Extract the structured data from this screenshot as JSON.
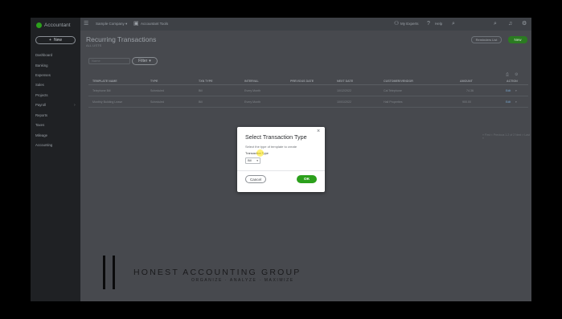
{
  "app": {
    "logo_text": "Accountant",
    "new_button": "New",
    "new_icon": "plus-icon"
  },
  "sidebar": {
    "items": [
      {
        "label": "Dashboard"
      },
      {
        "label": "Banking"
      },
      {
        "label": "Expenses"
      },
      {
        "label": "Sales"
      },
      {
        "label": "Projects"
      },
      {
        "label": "Payroll"
      },
      {
        "label": "Reports"
      },
      {
        "label": "Taxes"
      },
      {
        "label": "Mileage"
      },
      {
        "label": "Accounting"
      }
    ]
  },
  "topbar": {
    "company": "Sample Company",
    "tools_label": "Accountant Tools",
    "experts_label": "My Experts",
    "help_label": "Help"
  },
  "page": {
    "title": "Recurring Transactions",
    "subtitle": "ALL LISTS",
    "remind_list": "Reminders List",
    "new_label": "New",
    "filter_label": "Filter",
    "search_placeholder": "Name"
  },
  "table": {
    "headers": [
      "TEMPLATE NAME",
      "TYPE",
      "TXN TYPE",
      "INTERVAL",
      "PREVIOUS DATE",
      "NEXT DATE",
      "CUSTOMER/VENDOR",
      "AMOUNT",
      "ACTION"
    ],
    "rows": [
      {
        "name": "Telephone Bill",
        "type": "Scheduled",
        "txn": "Bill",
        "interval": "Every Month",
        "prev": "",
        "next": "10/12/2022",
        "party": "Cal Telephone",
        "amount": "74.36",
        "action": "Edit"
      },
      {
        "name": "Monthly Building Lease",
        "type": "Scheduled",
        "txn": "Bill",
        "interval": "Every Month",
        "prev": "",
        "next": "10/01/2022",
        "party": "Hall Properties",
        "amount": "900.00",
        "action": "Edit"
      }
    ],
    "pager": "« First  < Previous  1-2 of 2  Next >  Last »"
  },
  "modal": {
    "title": "Select Transaction Type",
    "description": "Select the type of template to create",
    "field_label": "Transaction Type",
    "field_value": "Bill",
    "cancel": "Cancel",
    "ok": "OK",
    "close_icon": "close-icon"
  },
  "watermark": {
    "title": "HONEST ACCOUNTING GROUP",
    "subtitle": "ORGANIZE · ANALYZE · MAXIMIZE"
  },
  "colors": {
    "accent": "#2ca01c",
    "sidebar": "#1f2124",
    "overlay": "#47494e"
  }
}
